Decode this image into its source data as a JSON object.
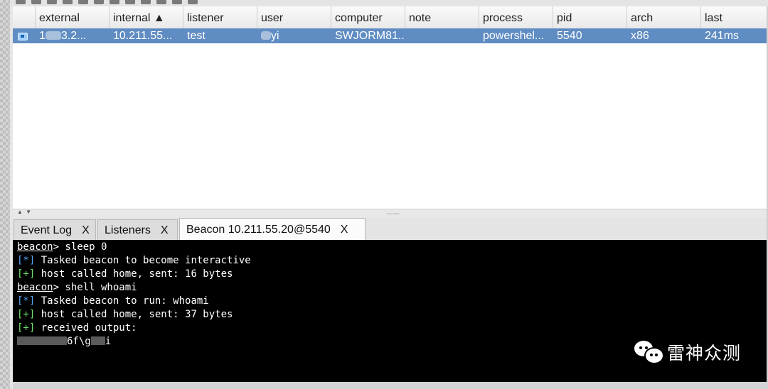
{
  "table": {
    "columns": [
      "",
      "external",
      "internal ▲",
      "listener",
      "user",
      "computer",
      "note",
      "process",
      "pid",
      "arch",
      "last"
    ],
    "rows": [
      {
        "icon": "beacon-icon",
        "external_pre": "1",
        "external_post": "3.2...",
        "internal": "10.211.55...",
        "listener": "test",
        "user": "yi",
        "computer": "SWJORM81...",
        "note": "",
        "process": "powershel...",
        "pid": "5540",
        "arch": "x86",
        "last": "241ms"
      }
    ]
  },
  "splitter": {
    "arrows": "▲ ▼",
    "grip": "⁓⁓"
  },
  "tabs": [
    {
      "label": "Event Log",
      "close": "X"
    },
    {
      "label": "Listeners",
      "close": "X"
    },
    {
      "label": "Beacon 10.211.55.20@5540",
      "close": "X",
      "active": true
    }
  ],
  "console": {
    "lines": [
      {
        "type": "prompt",
        "prompt": "beacon",
        "text": "> sleep 0"
      },
      {
        "type": "info",
        "marker": "[*]",
        "text": " Tasked beacon to become interactive"
      },
      {
        "type": "ok",
        "marker": "[+]",
        "text": " host called home, sent: 16 bytes"
      },
      {
        "type": "prompt",
        "prompt": "beacon",
        "text": "> shell whoami"
      },
      {
        "type": "info",
        "marker": "[*]",
        "text": " Tasked beacon to run: whoami"
      },
      {
        "type": "ok",
        "marker": "[+]",
        "text": " host called home, sent: 37 bytes"
      },
      {
        "type": "ok",
        "marker": "[+]",
        "text": " received output:"
      },
      {
        "type": "output",
        "mid": "6f\\g",
        "end": "i"
      }
    ]
  },
  "watermark": {
    "text": "雷神众测",
    "icon": "wechat-icon"
  },
  "colors": {
    "selected_row": "#5f8cc2",
    "console_bg": "#000000",
    "info": "#5aa3f0",
    "ok": "#6fe06a"
  }
}
